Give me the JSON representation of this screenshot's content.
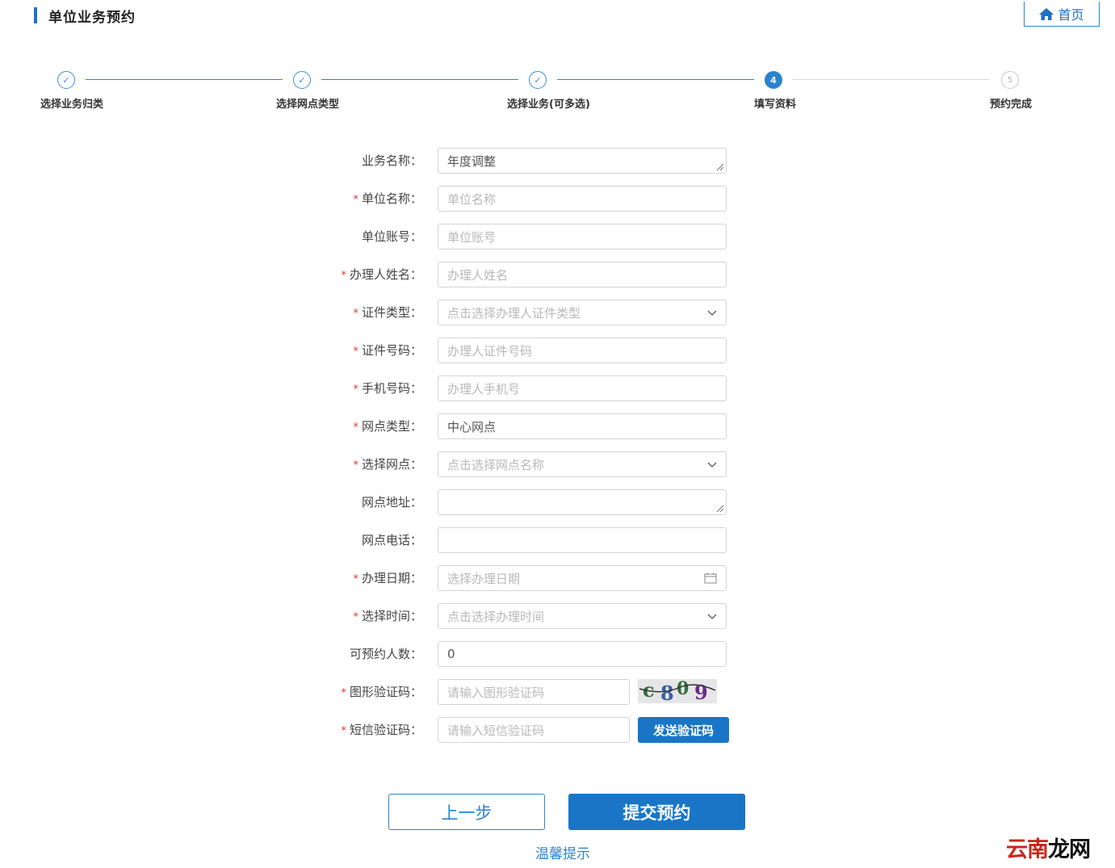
{
  "header": {
    "title": "单位业务预约",
    "home_label": "首页"
  },
  "steps": [
    {
      "label": "选择业务归类",
      "marker": "✓",
      "status": "done"
    },
    {
      "label": "选择网点类型",
      "marker": "✓",
      "status": "done"
    },
    {
      "label": "选择业务(可多选)",
      "marker": "✓",
      "status": "done"
    },
    {
      "label": "填写资料",
      "marker": "4",
      "status": "active"
    },
    {
      "label": "预约完成",
      "marker": "5",
      "status": "todo"
    }
  ],
  "form": {
    "business_name": {
      "label": "业务名称：",
      "value": "年度调整"
    },
    "unit_name": {
      "label": "单位名称：",
      "placeholder": "单位名称"
    },
    "unit_account": {
      "label": "单位账号：",
      "placeholder": "单位账号"
    },
    "handler_name": {
      "label": "办理人姓名：",
      "placeholder": "办理人姓名"
    },
    "id_type": {
      "label": "证件类型：",
      "placeholder": "点击选择办理人证件类型"
    },
    "id_number": {
      "label": "证件号码：",
      "placeholder": "办理人证件号码"
    },
    "phone": {
      "label": "手机号码：",
      "placeholder": "办理人手机号"
    },
    "outlet_type": {
      "label": "网点类型：",
      "value": "中心网点"
    },
    "outlet": {
      "label": "选择网点：",
      "placeholder": "点击选择网点名称"
    },
    "outlet_address": {
      "label": "网点地址：",
      "value": ""
    },
    "outlet_phone": {
      "label": "网点电话：",
      "value": ""
    },
    "date": {
      "label": "办理日期：",
      "placeholder": "选择办理日期"
    },
    "time": {
      "label": "选择时间：",
      "placeholder": "点击选择办理时间"
    },
    "capacity": {
      "label": "可预约人数：",
      "value": "0"
    },
    "captcha": {
      "label": "图形验证码：",
      "placeholder": "请输入图形验证码",
      "image_text": "c809"
    },
    "sms_code": {
      "label": "短信验证码：",
      "placeholder": "请输入短信验证码",
      "send_label": "发送验证码"
    },
    "required_mark": "*"
  },
  "actions": {
    "prev_label": "上一步",
    "submit_label": "提交预约",
    "tips_label": "温馨提示"
  },
  "watermark": {
    "part1": "云南",
    "part2": "龙网"
  },
  "colors": {
    "accent": "#1976c6",
    "required": "#e5332b",
    "placeholder": "#b8b8b8"
  }
}
